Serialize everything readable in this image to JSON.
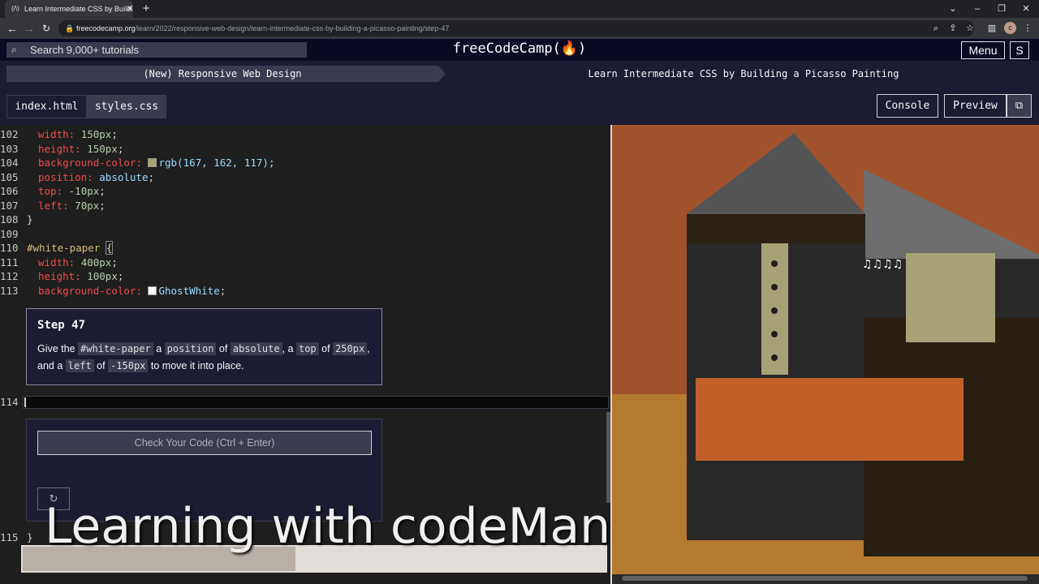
{
  "browser": {
    "tab_title": "Learn Intermediate CSS by Buildi",
    "tab_icon": "(/\\)",
    "url_host": "freecodecamp.org",
    "url_path": "/learn/2022/responsive-web-design/learn-intermediate-css-by-building-a-picasso-painting/step-47",
    "avatar_letter": "c"
  },
  "nav": {
    "search_placeholder": "Search 9,000+ tutorials",
    "brand": "freeCodeCamp(🔥)",
    "menu_label": "Menu",
    "signin_label": "S"
  },
  "breadcrumb": {
    "superblock": "(New) Responsive Web Design",
    "block": "Learn Intermediate CSS by Building a Picasso Painting"
  },
  "toolbar": {
    "tabs": [
      "index.html",
      "styles.css"
    ],
    "console_label": "Console",
    "preview_label": "Preview"
  },
  "editor": {
    "lines": [
      {
        "n": "102",
        "prop": "width",
        "val": "150px"
      },
      {
        "n": "103",
        "prop": "height",
        "val": "150px"
      },
      {
        "n": "104",
        "prop": "background-color",
        "val": "rgb(167, 162, 117)"
      },
      {
        "n": "105",
        "prop": "position",
        "val": "absolute"
      },
      {
        "n": "106",
        "prop": "top",
        "val": "-10px"
      },
      {
        "n": "107",
        "prop": "left",
        "val": "70px"
      },
      {
        "n": "108",
        "text": "}"
      },
      {
        "n": "109",
        "text": ""
      },
      {
        "n": "110",
        "selector": "#white-paper",
        "brace": "{"
      },
      {
        "n": "111",
        "prop": "width",
        "val": "400px"
      },
      {
        "n": "112",
        "prop": "height",
        "val": "100px"
      },
      {
        "n": "113",
        "prop": "background-color",
        "val": "GhostWhite"
      }
    ],
    "edit_line_number": "114",
    "last_line_number": "115",
    "last_line_text": "}",
    "swatch_colors": {
      "rgb": "#a7a275",
      "ghostwhite": "#f8f8ff"
    }
  },
  "step": {
    "title": "Step 47",
    "desc_parts": [
      "Give the ",
      "#white-paper",
      " a ",
      "position",
      " of ",
      "absolute",
      ", a ",
      "top",
      " of ",
      "250px",
      ", and a ",
      "left",
      " of ",
      "-150px",
      " to move it into place."
    ]
  },
  "actions": {
    "check_label": "Check Your Code (Ctrl + Enter)",
    "reset_icon": "↻"
  },
  "watermark": "Learning with codeManS",
  "preview": {
    "colors": {
      "background": "#a0522d",
      "bottom": "#b47a2f",
      "black_dress": "#282828",
      "dark_shadow": "#2a1e10",
      "grey": "#555555",
      "tan": "#a7a275",
      "orange": "#c2602a",
      "hat_brim": "#2c2015",
      "gray_hat": "#6d6d6d"
    },
    "music": "♫♫♫♫"
  }
}
